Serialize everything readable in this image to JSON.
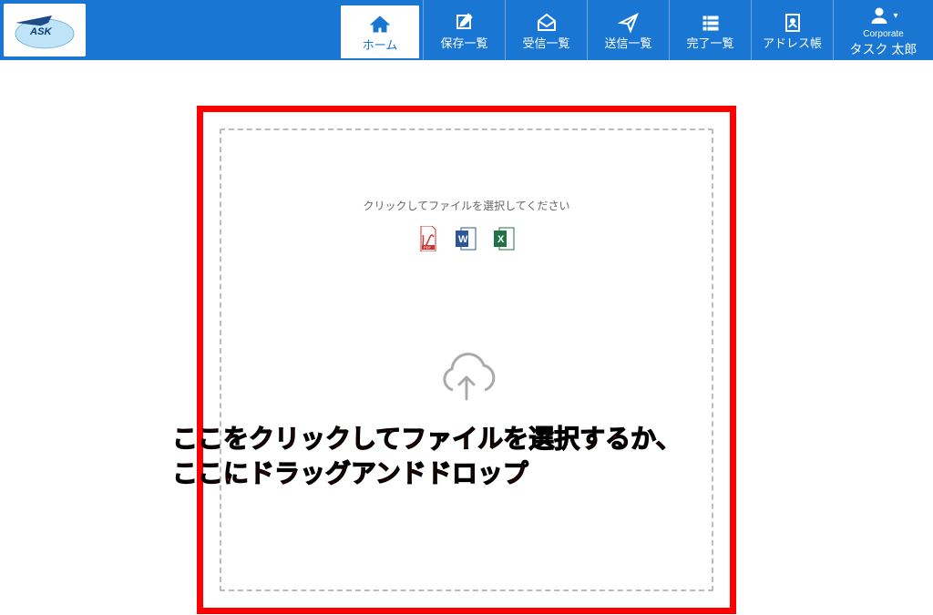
{
  "logo": {
    "text": "ASK"
  },
  "nav": {
    "home": "ホーム",
    "saved": "保存一覧",
    "inbox": "受信一覧",
    "sent": "送信一覧",
    "done": "完了一覧",
    "address": "アドレス帳"
  },
  "user": {
    "sub": "Corporate",
    "name": "タスク 太郎"
  },
  "dropzone": {
    "hint": "クリックしてファイルを選択してください"
  },
  "overlay": {
    "line1": "ここをクリックしてファイルを選択するか、",
    "line2": "ここにドラッグアンドドロップ"
  }
}
